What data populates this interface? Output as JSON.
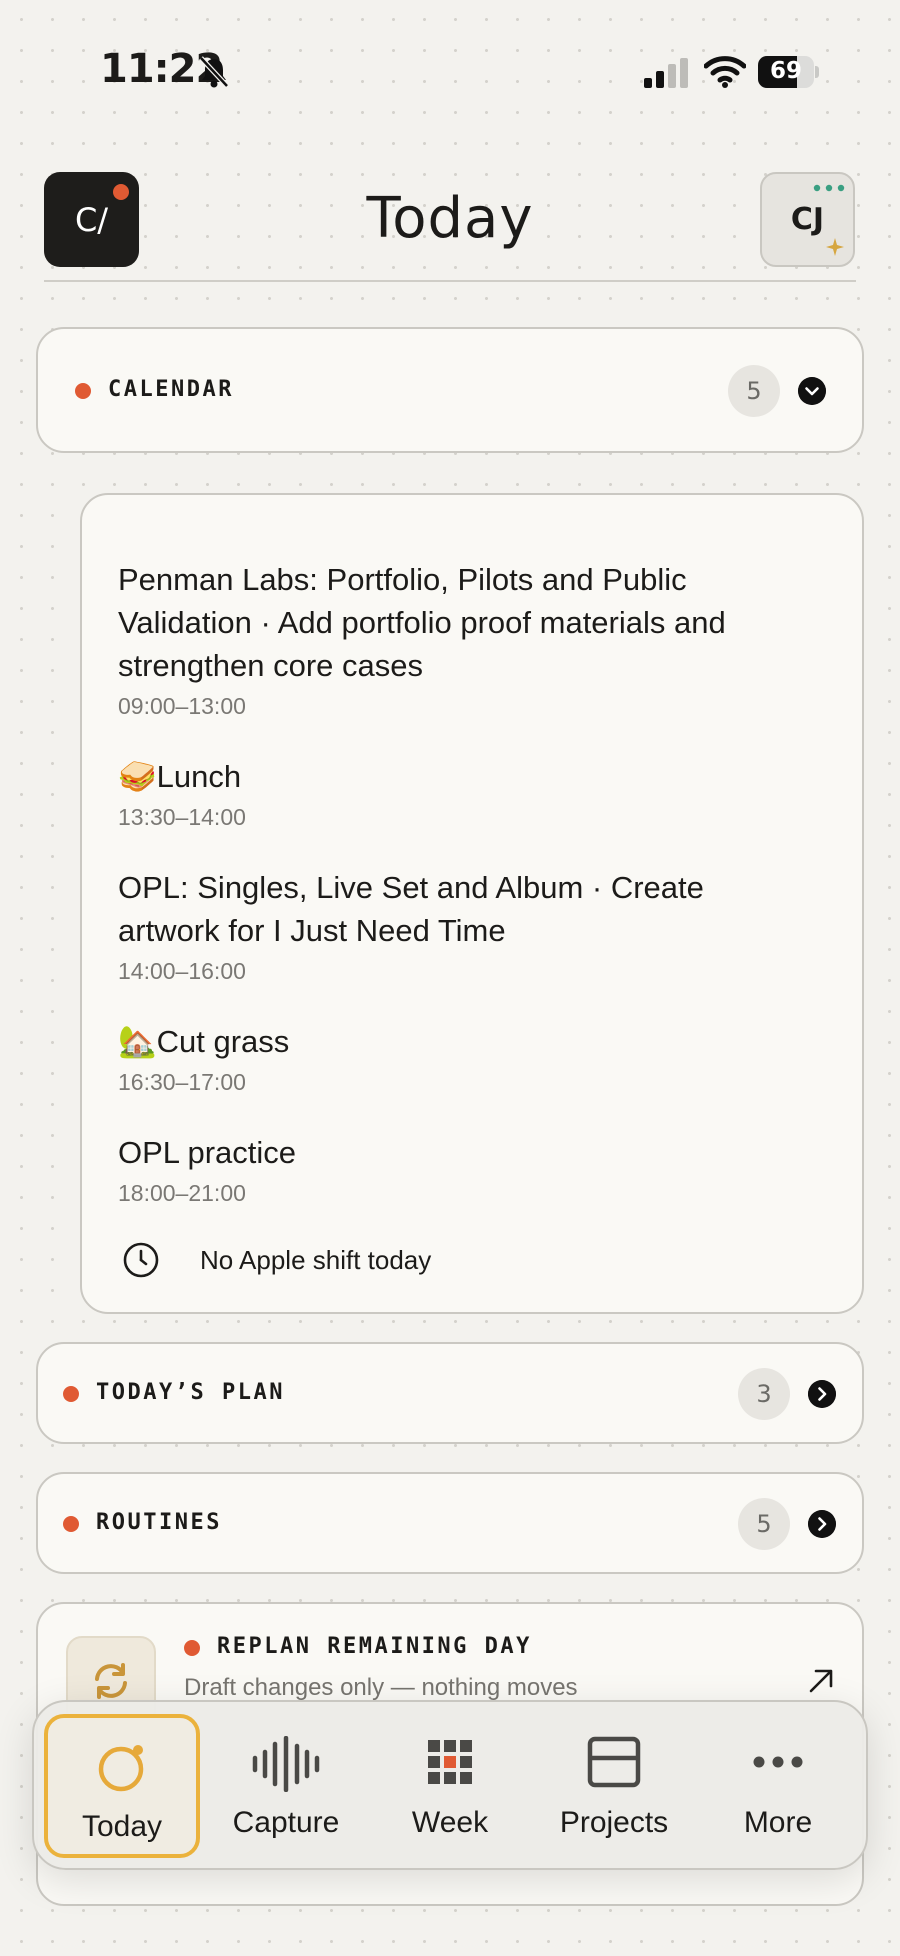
{
  "status_bar": {
    "time": "11:22",
    "battery": "69",
    "battery_level": 0.69
  },
  "header": {
    "logo_text": "C/",
    "title": "Today",
    "avatar_initials": "CJ"
  },
  "calendar": {
    "label": "CALENDAR",
    "count": "5",
    "events": [
      {
        "title": "Penman Labs: Portfolio, Pilots and Public Validation · Add portfolio proof materials and strengthen core cases",
        "time": "09:00–13:00"
      },
      {
        "title": "🥪Lunch",
        "time": "13:30–14:00"
      },
      {
        "title": "OPL: Singles, Live Set and Album · Create artwork for I Just Need Time",
        "time": "14:00–16:00"
      },
      {
        "title": "🏡Cut grass",
        "time": "16:30–17:00"
      },
      {
        "title": "OPL practice",
        "time": "18:00–21:00"
      }
    ],
    "shift_note": "No Apple shift today"
  },
  "todays_plan": {
    "label": "TODAY’S PLAN",
    "count": "3"
  },
  "routines": {
    "label": "ROUTINES",
    "count": "5"
  },
  "replan": {
    "label": "REPLAN REMAINING DAY",
    "subtitle": "Draft changes only — nothing moves"
  },
  "tabs": [
    {
      "label": "Today",
      "icon": "today-ring-icon",
      "active": true
    },
    {
      "label": "Capture",
      "icon": "waveform-icon",
      "active": false
    },
    {
      "label": "Week",
      "icon": "grid-icon",
      "active": false
    },
    {
      "label": "Projects",
      "icon": "folder-icon",
      "active": false
    },
    {
      "label": "More",
      "icon": "ellipsis-icon",
      "active": false
    }
  ],
  "colors": {
    "accent": "#e05a33",
    "active_tab_border": "#ebb23c",
    "background": "#f3f2ee",
    "card": "#faf9f5"
  }
}
